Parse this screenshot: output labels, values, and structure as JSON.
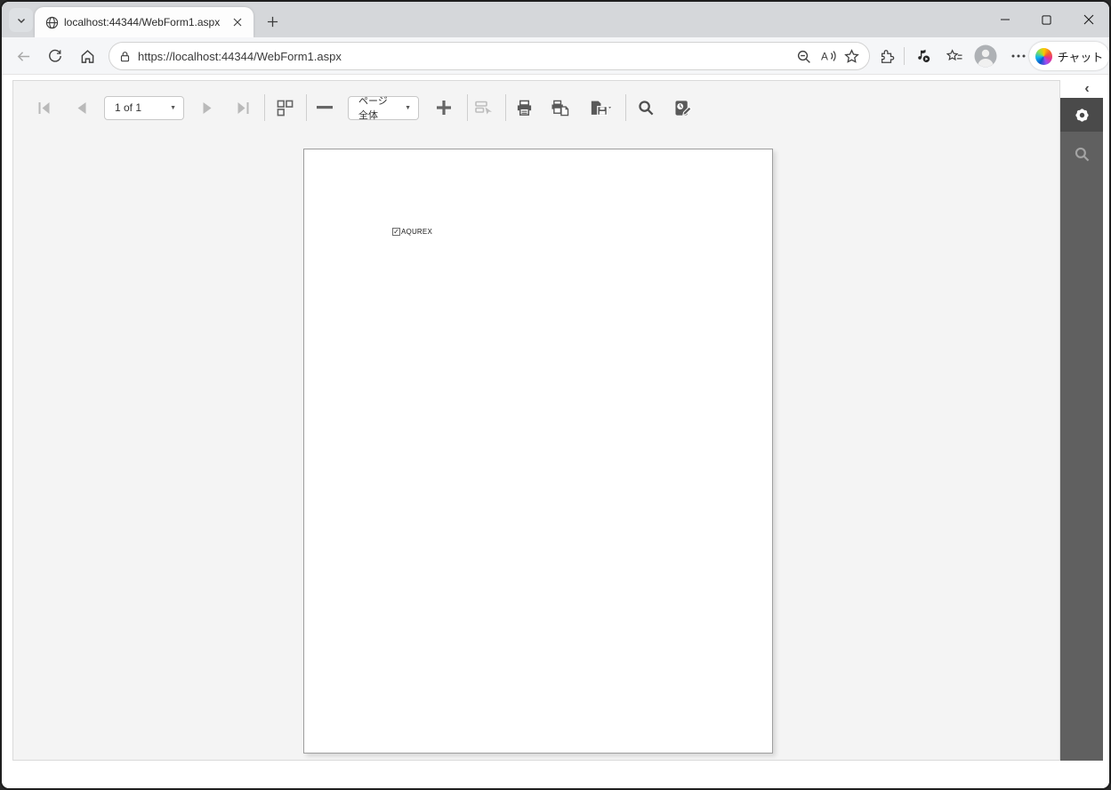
{
  "titlebar": {
    "tab_title": "localhost:44344/WebForm1.aspx"
  },
  "toolbar": {
    "url": "https://localhost:44344/WebForm1.aspx",
    "copilot_label": "チャット"
  },
  "viewer": {
    "page_indicator": "1 of 1",
    "zoom_mode": "ページ全体"
  },
  "document": {
    "checkbox_checked": true,
    "label": "AQUREX"
  },
  "icons": {
    "caret_down": "▼",
    "check": "✓",
    "chevron_left": "‹"
  },
  "colors": {
    "titlebar_bg": "#d5d7da",
    "addressbar_bg": "#f5f6f8",
    "viewer_bg": "#f4f4f4",
    "sidebar_bg": "#606060",
    "sidebar_active_bg": "#4a4a4a",
    "page_border": "#9d9d9d",
    "toolbar_icon": "#595959",
    "disabled_icon": "#bdbdbd"
  }
}
